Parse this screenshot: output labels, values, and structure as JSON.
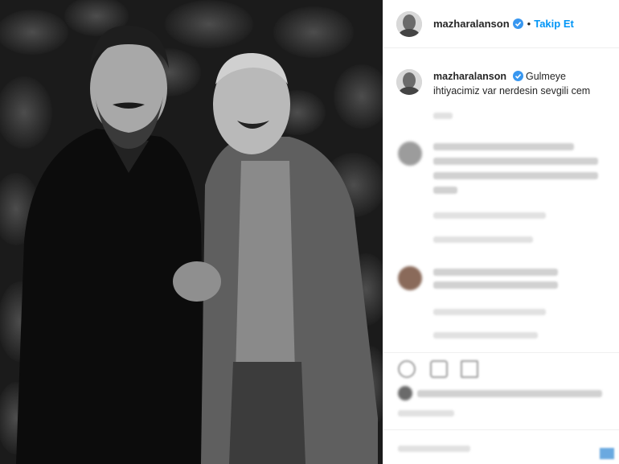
{
  "post": {
    "username": "mazharalanson",
    "follow_label": "Takip Et",
    "separator": "•"
  },
  "caption": {
    "username": "mazharalanson",
    "text": "Gulmeye ihtiyacimiz var nerdesin sevgili cem"
  },
  "icons": {
    "verified": "verified-badge-icon",
    "like": "heart-icon",
    "comment": "comment-icon",
    "share": "share-icon"
  },
  "colors": {
    "accent": "#0095f6",
    "text": "#262626",
    "border": "#efefef"
  }
}
